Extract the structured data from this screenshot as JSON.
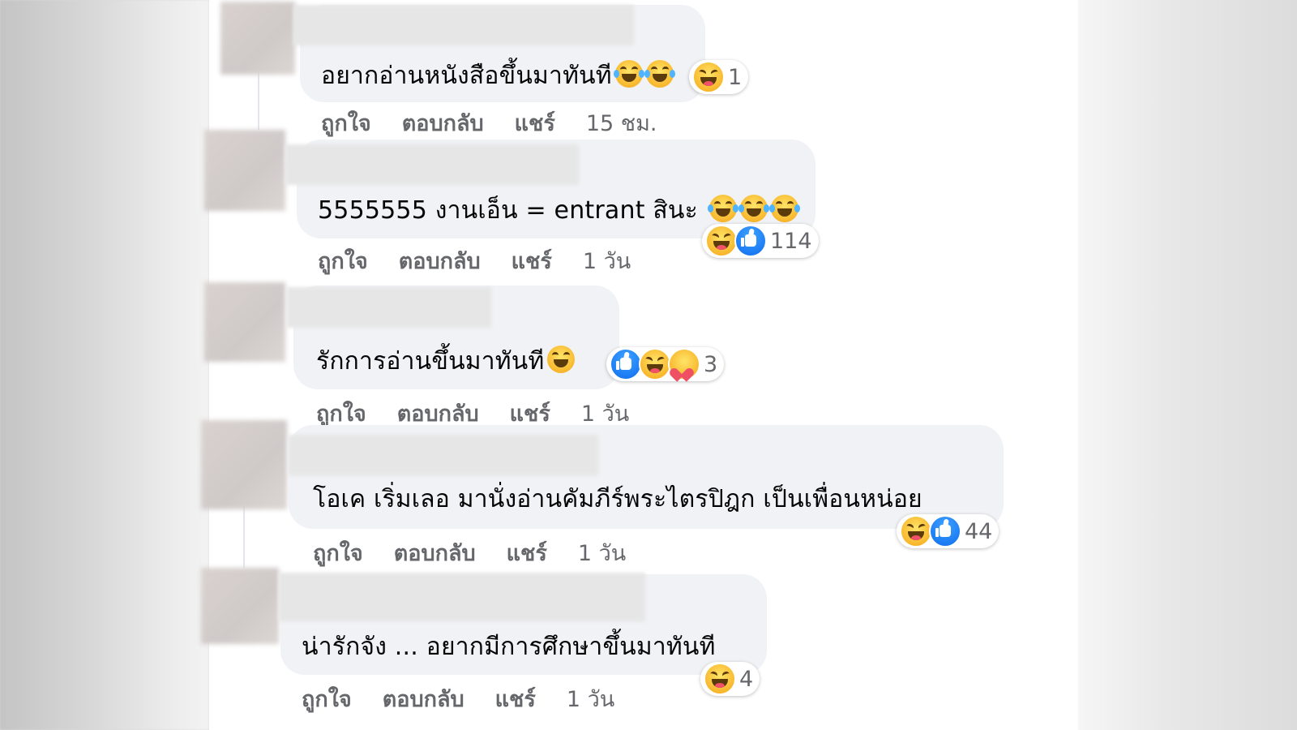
{
  "comments": [
    {
      "text": "อยากอ่านหนังสือขึ้นมาทันที",
      "emojis": [
        "tears-of-joy-emoji",
        "tears-of-joy-emoji"
      ],
      "reactions": [
        "haha-icon"
      ],
      "reaction_count": "1",
      "actions": {
        "like": "ถูกใจ",
        "reply": "ตอบกลับ",
        "share": "แชร์"
      },
      "time": "15 ชม."
    },
    {
      "text": "5555555 งานเอ็น = entrant สินะ",
      "emojis": [
        "tears-of-joy-emoji",
        "tears-of-joy-emoji",
        "tears-of-joy-emoji"
      ],
      "reactions": [
        "haha-icon",
        "like-icon"
      ],
      "reaction_count": "114",
      "actions": {
        "like": "ถูกใจ",
        "reply": "ตอบกลับ",
        "share": "แชร์"
      },
      "time": "1 วัน"
    },
    {
      "text": "รักการอ่านขึ้นมาทันที",
      "emojis": [
        "grinning-squinting-emoji"
      ],
      "reactions": [
        "like-icon",
        "haha-icon",
        "care-icon"
      ],
      "reaction_count": "3",
      "actions": {
        "like": "ถูกใจ",
        "reply": "ตอบกลับ",
        "share": "แชร์"
      },
      "time": "1 วัน"
    },
    {
      "text": "โอเค เริ่มเลอ มานั่งอ่านคัมภีร์พระไตรปิฎก เป็นเพื่อนหน่อย",
      "emojis": [],
      "reactions": [
        "haha-icon",
        "like-icon"
      ],
      "reaction_count": "44",
      "actions": {
        "like": "ถูกใจ",
        "reply": "ตอบกลับ",
        "share": "แชร์"
      },
      "time": "1 วัน"
    },
    {
      "text": "น่ารักจัง ... อยากมีการศึกษาขึ้นมาทันที",
      "emojis": [],
      "reactions": [
        "haha-icon"
      ],
      "reaction_count": "4",
      "actions": {
        "like": "ถูกใจ",
        "reply": "ตอบกลับ",
        "share": "แชร์"
      },
      "time": "1 วัน"
    }
  ]
}
